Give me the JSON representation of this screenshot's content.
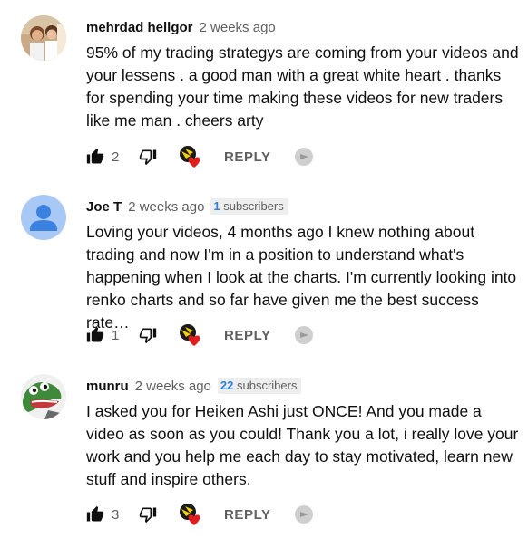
{
  "comments": [
    {
      "author": "mehrdad hellgor",
      "time": "2 weeks ago",
      "subscribers": null,
      "text": "95% of my trading strategys are coming from your videos and your lessens . a good man with a great white heart . thanks for spending your time making these videos for new traders like me man . cheers arty",
      "likes": "2",
      "reply_label": "REPLY",
      "avatar": "photo-avatar"
    },
    {
      "author": "Joe T",
      "time": "2 weeks ago",
      "subscribers": {
        "count": "1",
        "label": " subscribers"
      },
      "text": "Loving your videos, 4 months ago I knew nothing about trading and now I'm in a position to understand what's happening when I look at the charts. I'm currently looking into renko charts and so far have given me the best success rate…",
      "likes": "1",
      "reply_label": "REPLY",
      "avatar": "default-person-avatar"
    },
    {
      "author": "munru",
      "time": "2 weeks ago",
      "subscribers": {
        "count": "22",
        "label": " subscribers"
      },
      "text": "I asked you for Heiken Ashi just ONCE! And you made a video as soon as you could! Thank you a lot, i really love your work and you help me each day to stay motivated, learn new stuff and inspire others.",
      "likes": "3",
      "reply_label": "REPLY",
      "avatar": "frog-avatar"
    }
  ],
  "colors": {
    "author": "#0f0f0f",
    "secondary": "#606060",
    "subs_number": "#2f7fd4",
    "heart": "#e01e1e",
    "default_avatar_bg": "#aac8f5",
    "default_avatar_fg": "#3b82e0"
  },
  "icons": {
    "like": "thumbs-up-filled-icon",
    "dislike": "thumbs-down-outline-icon",
    "creator_heart": "creator-heart-icon",
    "extension": "grey-round-icon"
  }
}
